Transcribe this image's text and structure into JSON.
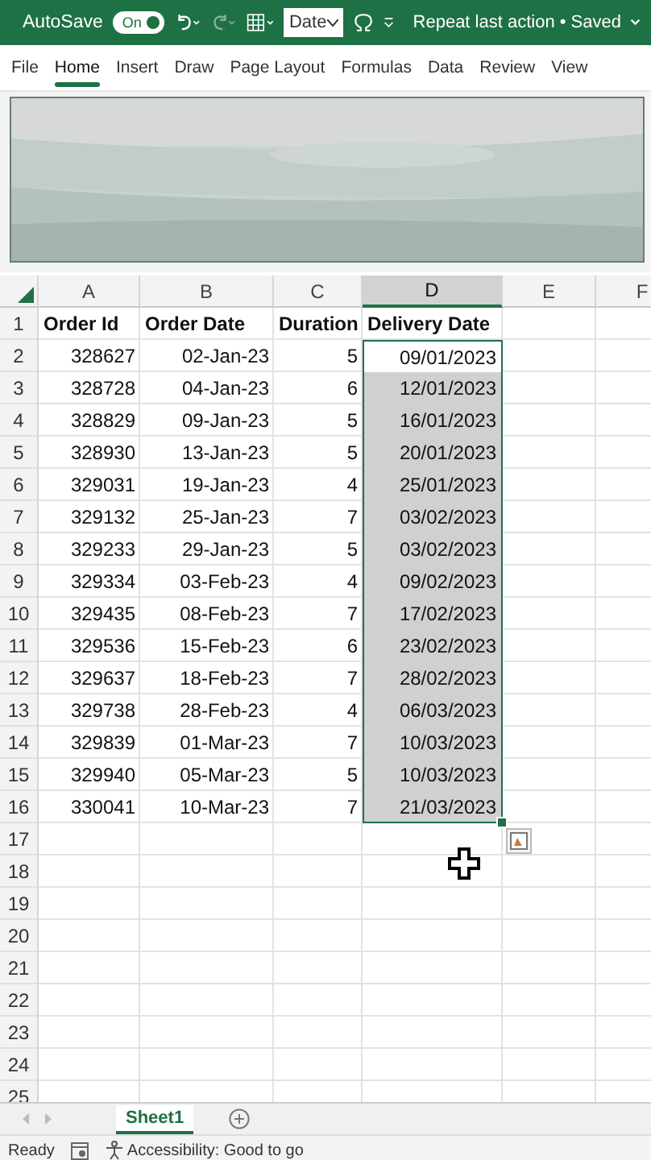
{
  "title_bar": {
    "autosave_label": "AutoSave",
    "autosave_toggle": {
      "label": "On",
      "on": true
    },
    "name_box": "Date",
    "status_text": "Repeat last action • Saved"
  },
  "ribbon_tabs": [
    {
      "label": "File",
      "selected": false
    },
    {
      "label": "Home",
      "selected": true
    },
    {
      "label": "Insert",
      "selected": false
    },
    {
      "label": "Draw",
      "selected": false
    },
    {
      "label": "Page Layout",
      "selected": false
    },
    {
      "label": "Formulas",
      "selected": false
    },
    {
      "label": "Data",
      "selected": false
    },
    {
      "label": "Review",
      "selected": false
    },
    {
      "label": "View",
      "selected": false
    }
  ],
  "sheet": {
    "columns": [
      {
        "label": "A",
        "selected": false
      },
      {
        "label": "B",
        "selected": false
      },
      {
        "label": "C",
        "selected": false
      },
      {
        "label": "D",
        "selected": true
      },
      {
        "label": "E",
        "selected": false
      },
      {
        "label": "F",
        "selected": false
      }
    ],
    "rows": [
      {
        "number": "1",
        "cells": [
          {
            "text": "Order Id",
            "selected": false
          },
          {
            "text": "Order Date",
            "selected": false
          },
          {
            "text": "Duration",
            "selected": false
          },
          {
            "text": "Delivery Date",
            "selected": false
          }
        ]
      },
      {
        "number": "2",
        "cells": [
          {
            "text": "328627",
            "selected": false
          },
          {
            "text": "02-Jan-23",
            "selected": false
          },
          {
            "text": "5",
            "selected": false
          },
          {
            "text": "09/01/2023",
            "selected": true,
            "active": true
          }
        ]
      },
      {
        "number": "3",
        "cells": [
          {
            "text": "328728",
            "selected": false
          },
          {
            "text": "04-Jan-23",
            "selected": false
          },
          {
            "text": "6",
            "selected": false
          },
          {
            "text": "12/01/2023",
            "selected": true,
            "active": false
          }
        ]
      },
      {
        "number": "4",
        "cells": [
          {
            "text": "328829",
            "selected": false
          },
          {
            "text": "09-Jan-23",
            "selected": false
          },
          {
            "text": "5",
            "selected": false
          },
          {
            "text": "16/01/2023",
            "selected": true,
            "active": false
          }
        ]
      },
      {
        "number": "5",
        "cells": [
          {
            "text": "328930",
            "selected": false
          },
          {
            "text": "13-Jan-23",
            "selected": false
          },
          {
            "text": "5",
            "selected": false
          },
          {
            "text": "20/01/2023",
            "selected": true,
            "active": false
          }
        ]
      },
      {
        "number": "6",
        "cells": [
          {
            "text": "329031",
            "selected": false
          },
          {
            "text": "19-Jan-23",
            "selected": false
          },
          {
            "text": "4",
            "selected": false
          },
          {
            "text": "25/01/2023",
            "selected": true,
            "active": false
          }
        ]
      },
      {
        "number": "7",
        "cells": [
          {
            "text": "329132",
            "selected": false
          },
          {
            "text": "25-Jan-23",
            "selected": false
          },
          {
            "text": "7",
            "selected": false
          },
          {
            "text": "03/02/2023",
            "selected": true,
            "active": false
          }
        ]
      },
      {
        "number": "8",
        "cells": [
          {
            "text": "329233",
            "selected": false
          },
          {
            "text": "29-Jan-23",
            "selected": false
          },
          {
            "text": "5",
            "selected": false
          },
          {
            "text": "03/02/2023",
            "selected": true,
            "active": false
          }
        ]
      },
      {
        "number": "9",
        "cells": [
          {
            "text": "329334",
            "selected": false
          },
          {
            "text": "03-Feb-23",
            "selected": false
          },
          {
            "text": "4",
            "selected": false
          },
          {
            "text": "09/02/2023",
            "selected": true,
            "active": false
          }
        ]
      },
      {
        "number": "10",
        "cells": [
          {
            "text": "329435",
            "selected": false
          },
          {
            "text": "08-Feb-23",
            "selected": false
          },
          {
            "text": "7",
            "selected": false
          },
          {
            "text": "17/02/2023",
            "selected": true,
            "active": false
          }
        ]
      },
      {
        "number": "11",
        "cells": [
          {
            "text": "329536",
            "selected": false
          },
          {
            "text": "15-Feb-23",
            "selected": false
          },
          {
            "text": "6",
            "selected": false
          },
          {
            "text": "23/02/2023",
            "selected": true,
            "active": false
          }
        ]
      },
      {
        "number": "12",
        "cells": [
          {
            "text": "329637",
            "selected": false
          },
          {
            "text": "18-Feb-23",
            "selected": false
          },
          {
            "text": "7",
            "selected": false
          },
          {
            "text": "28/02/2023",
            "selected": true,
            "active": false
          }
        ]
      },
      {
        "number": "13",
        "cells": [
          {
            "text": "329738",
            "selected": false
          },
          {
            "text": "28-Feb-23",
            "selected": false
          },
          {
            "text": "4",
            "selected": false
          },
          {
            "text": "06/03/2023",
            "selected": true,
            "active": false
          }
        ]
      },
      {
        "number": "14",
        "cells": [
          {
            "text": "329839",
            "selected": false
          },
          {
            "text": "01-Mar-23",
            "selected": false
          },
          {
            "text": "7",
            "selected": false
          },
          {
            "text": "10/03/2023",
            "selected": true,
            "active": false
          }
        ]
      },
      {
        "number": "15",
        "cells": [
          {
            "text": "329940",
            "selected": false
          },
          {
            "text": "05-Mar-23",
            "selected": false
          },
          {
            "text": "5",
            "selected": false
          },
          {
            "text": "10/03/2023",
            "selected": true,
            "active": false
          }
        ]
      },
      {
        "number": "16",
        "cells": [
          {
            "text": "330041",
            "selected": false
          },
          {
            "text": "10-Mar-23",
            "selected": false
          },
          {
            "text": "7",
            "selected": false
          },
          {
            "text": "21/03/2023",
            "selected": true,
            "active": false
          }
        ]
      },
      {
        "number": "17",
        "cells": []
      },
      {
        "number": "18",
        "cells": []
      },
      {
        "number": "19",
        "cells": []
      },
      {
        "number": "20",
        "cells": []
      },
      {
        "number": "21",
        "cells": []
      },
      {
        "number": "22",
        "cells": []
      },
      {
        "number": "23",
        "cells": []
      },
      {
        "number": "24",
        "cells": []
      },
      {
        "number": "25",
        "cells": []
      }
    ]
  },
  "sheet_tabs": [
    {
      "label": "Sheet1",
      "selected": true
    }
  ],
  "status_bar": {
    "mode": "Ready",
    "accessibility": "Accessibility: Good to go"
  }
}
